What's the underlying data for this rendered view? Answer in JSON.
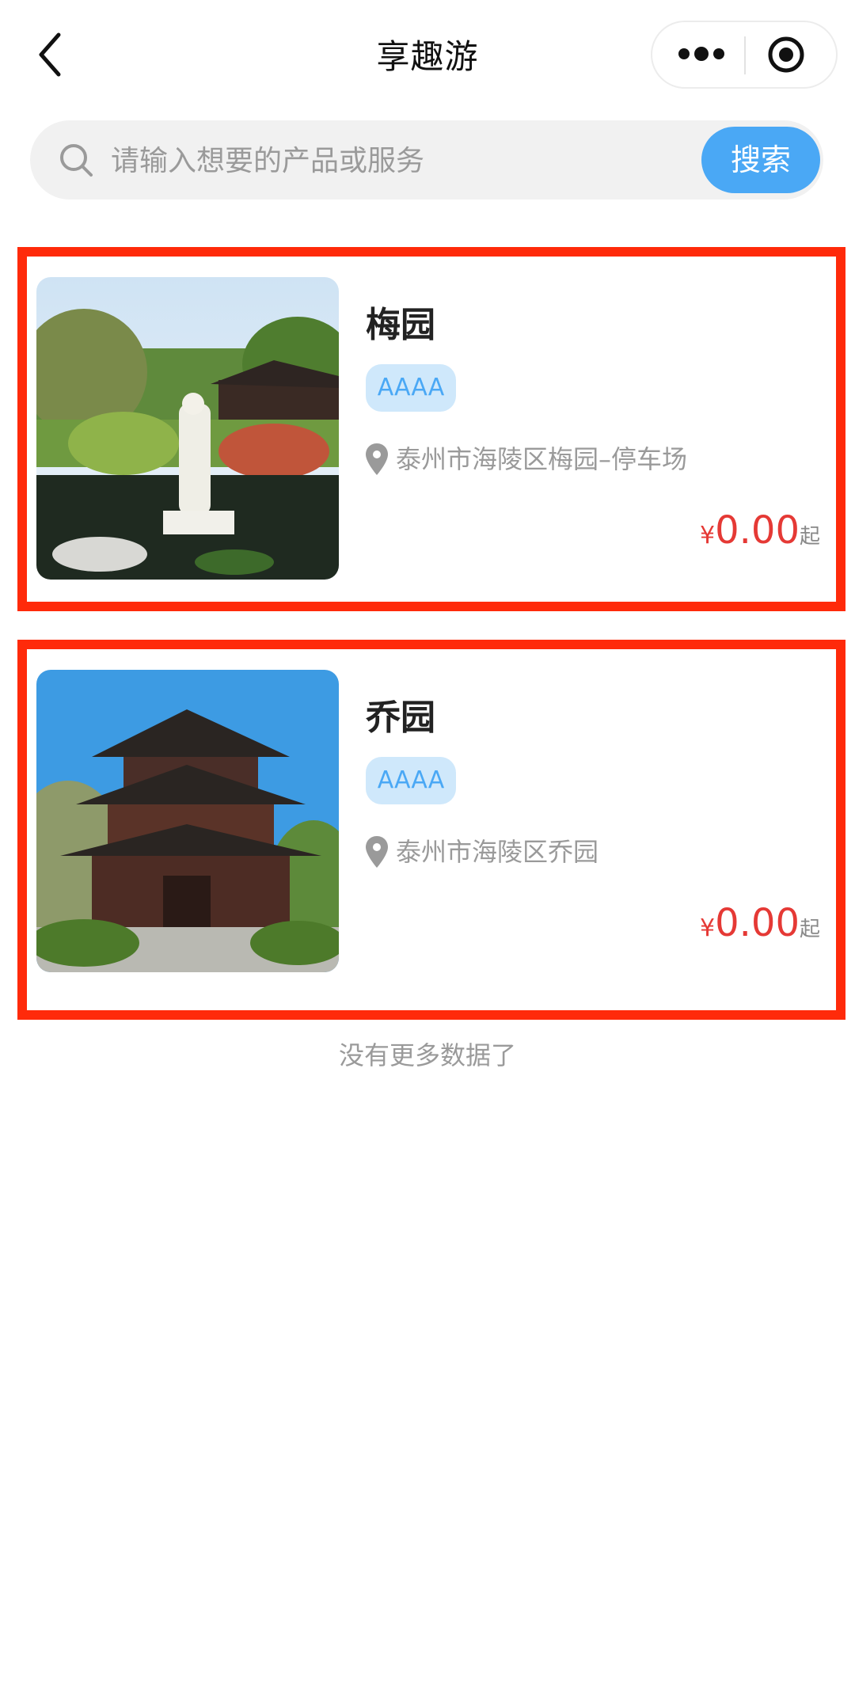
{
  "nav": {
    "title": "享趣游"
  },
  "search": {
    "placeholder": "请输入想要的产品或服务",
    "button_label": "搜索"
  },
  "items": [
    {
      "title": "梅园",
      "badge": "AAAA",
      "location": "泰州市海陵区梅园–停车场",
      "currency": "¥",
      "price": "0.00",
      "suffix": "起"
    },
    {
      "title": "乔园",
      "badge": "AAAA",
      "location": "泰州市海陵区乔园",
      "currency": "¥",
      "price": "0.00",
      "suffix": "起"
    }
  ],
  "footer": {
    "text": "没有更多数据了"
  },
  "colors": {
    "accent": "#4aa8f5",
    "price": "#e53935",
    "highlight_border": "#ff2a0a",
    "badge_bg": "#cfe8fb"
  },
  "icons": {
    "back": "chevron-left-icon",
    "more": "more-dots-icon",
    "target": "target-icon",
    "search": "search-icon",
    "location": "location-pin-icon"
  }
}
